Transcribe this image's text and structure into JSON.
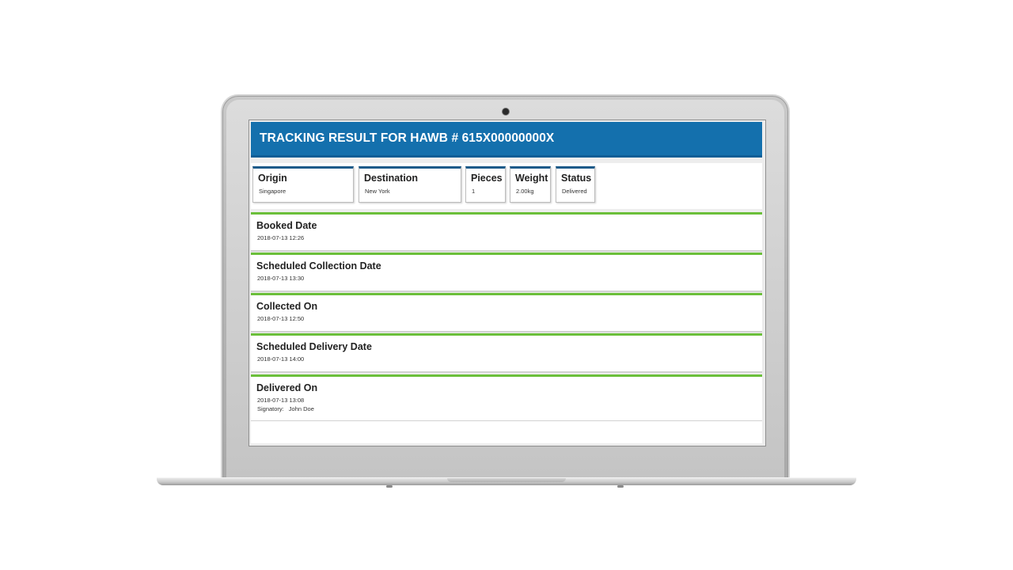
{
  "header": {
    "title": "TRACKING RESULT FOR HAWB # 615X00000000X"
  },
  "summary": [
    {
      "label": "Origin",
      "value": "Singapore"
    },
    {
      "label": "Destination",
      "value": "New York"
    },
    {
      "label": "Pieces",
      "value": "1"
    },
    {
      "label": "Weight",
      "value": "2.00kg"
    },
    {
      "label": "Status",
      "value": "Delivered"
    }
  ],
  "events": [
    {
      "label": "Booked Date",
      "value": "2018-07-13 12:26"
    },
    {
      "label": "Scheduled Collection Date",
      "value": "2018-07-13 13:30"
    },
    {
      "label": "Collected On",
      "value": "2018-07-13 12:50"
    },
    {
      "label": "Scheduled Delivery Date",
      "value": "2018-07-13 14:00"
    },
    {
      "label": "Delivered On",
      "value": "2018-07-13 13:08",
      "signatory_label": "Signatory:",
      "signatory": "John Doe"
    }
  ],
  "colors": {
    "header": "#1470ad",
    "summary_accent": "#1c5b8a",
    "event_accent": "#6bbf3a"
  }
}
